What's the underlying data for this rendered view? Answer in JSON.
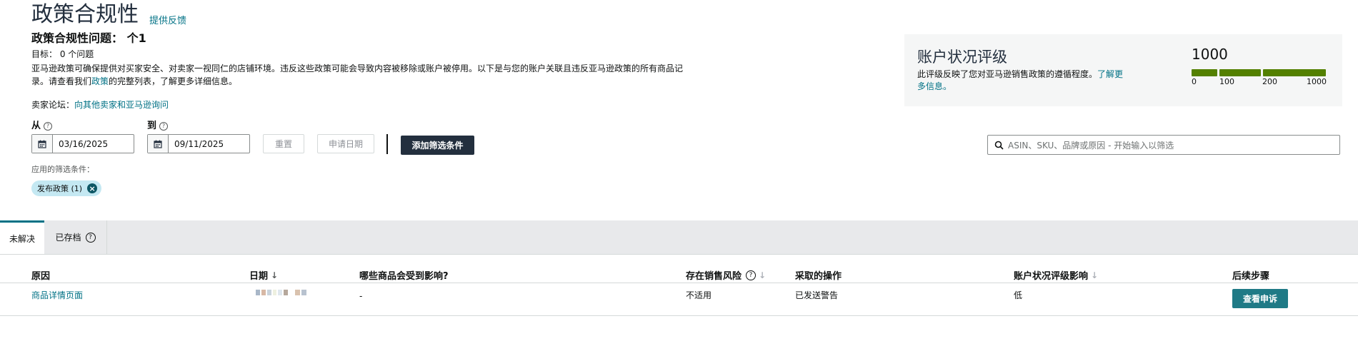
{
  "header": {
    "title": "政策合规性",
    "feedback_link": "提供反馈",
    "issues_label": "政策合规性问题：",
    "issues_count": "个1",
    "goal_label": "目标：",
    "goal_value": "0 个问题",
    "description_pre": "亚马逊政策可确保提供对买家安全、对卖家一视同仁的店铺环境。违反这些政策可能会导致内容被移除或账户被停用。以下是与您的账户关联且违反亚马逊政策的所有商品记录。请查看我们",
    "description_link": "政策",
    "description_post": "的完整列表，了解更多详细信息。",
    "forum_label": "卖家论坛：",
    "forum_link": "向其他卖家和亚马逊询问"
  },
  "account_health": {
    "title": "账户状况评级",
    "description": "此评级反映了您对亚马逊销售政策的遵循程度。",
    "learn_more": "了解更多信息。",
    "score": "1000",
    "ticks": [
      "0",
      "100",
      "200",
      "1000"
    ],
    "bar_color": "#538000"
  },
  "filters": {
    "from_label": "从",
    "to_label": "到",
    "from_date": "03/16/2025",
    "to_date": "09/11/2025",
    "reset_label": "重置",
    "apply_label": "申请日期",
    "add_filter_label": "添加筛选条件",
    "search_placeholder": "ASIN、SKU、品牌或原因 - 开始输入以筛选",
    "applied_label": "应用的筛选条件：",
    "chip_label": "发布政策 (1)"
  },
  "tabs": [
    {
      "label": "未解决",
      "active": true
    },
    {
      "label": "已存档",
      "active": false
    }
  ],
  "table": {
    "columns": [
      "原因",
      "日期",
      "哪些商品会受到影响?",
      "存在销售风险",
      "采取的操作",
      "账户状况评级影响",
      "后续步骤"
    ],
    "rows": [
      {
        "reason": "商品详情页面",
        "date": "",
        "affected": "-",
        "risk": "不适用",
        "action": "已发送警告",
        "impact": "低",
        "next_step": "查看申诉"
      }
    ]
  },
  "colors": {
    "link": "#007185",
    "dark_button": "#232f3e",
    "teal_button": "#1f7a86",
    "chip_bg": "#c4e8f2"
  }
}
